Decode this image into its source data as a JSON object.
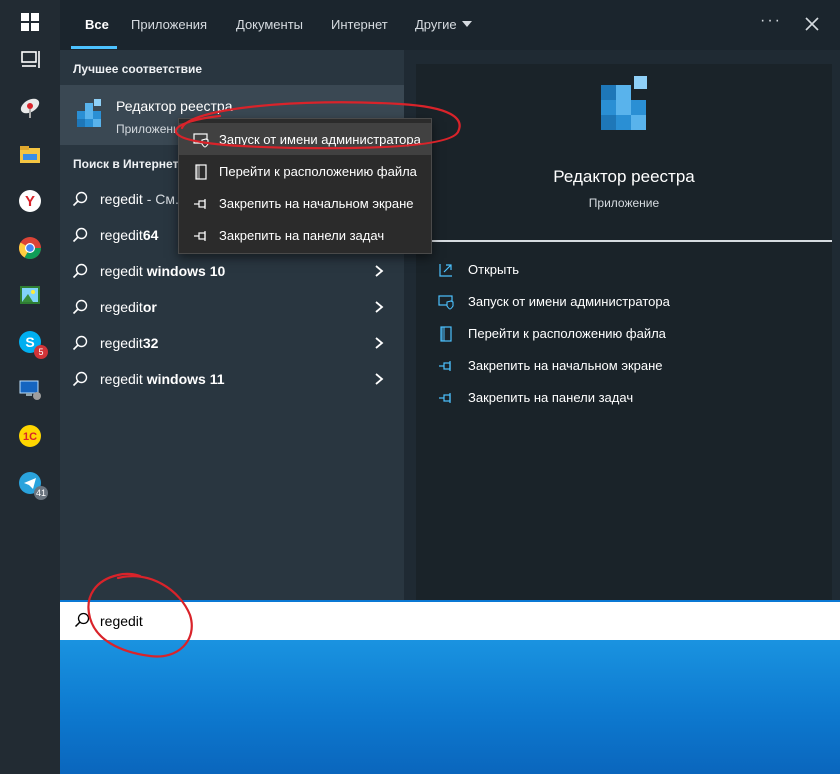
{
  "tabs": [
    {
      "label": "Все",
      "active": true
    },
    {
      "label": "Приложения"
    },
    {
      "label": "Документы"
    },
    {
      "label": "Интернет"
    },
    {
      "label": "Другие"
    }
  ],
  "more_label": "···",
  "best_match": {
    "section": "Лучшее соответствие",
    "title": "Редактор реестра",
    "subtitle": "Приложение"
  },
  "web": {
    "section": "Поиск в Интернете",
    "items": [
      {
        "prefix": "regedit",
        "suffix": " - См...",
        "bold_suffix": false
      },
      {
        "prefix": "regedit",
        "suffix": "64",
        "bold_suffix": true
      },
      {
        "prefix": "regedit",
        "suffix": " windows 10",
        "bold_suffix": true
      },
      {
        "prefix": "regedit",
        "suffix": "or",
        "bold_suffix": true
      },
      {
        "prefix": "regedit",
        "suffix": "32",
        "bold_suffix": true
      },
      {
        "prefix": "regedit",
        "suffix": " windows 11",
        "bold_suffix": true
      }
    ]
  },
  "context_menu": {
    "items": [
      {
        "label": "Запуск от имени администратора",
        "icon": "run-as-admin-icon"
      },
      {
        "label": "Перейти к расположению файла",
        "icon": "open-file-location-icon"
      },
      {
        "label": "Закрепить на начальном экране",
        "icon": "pin-icon"
      },
      {
        "label": "Закрепить на панели задач",
        "icon": "pin-icon"
      }
    ]
  },
  "details": {
    "title": "Редактор реестра",
    "subtitle": "Приложение",
    "actions": [
      {
        "label": "Открыть",
        "icon": "open-icon"
      },
      {
        "label": "Запуск от имени администратора",
        "icon": "run-as-admin-icon"
      },
      {
        "label": "Перейти к расположению файла",
        "icon": "open-file-location-icon"
      },
      {
        "label": "Закрепить на начальном экране",
        "icon": "pin-icon"
      },
      {
        "label": "Закрепить на панели задач",
        "icon": "pin-icon"
      }
    ]
  },
  "search": {
    "value": "regedit"
  },
  "taskbar": {
    "badges": {
      "skype": "5",
      "telegram": "41"
    }
  },
  "colors": {
    "accent": "#4cc2ff",
    "annotation": "#d9232a",
    "panel": "#1f2a33",
    "context_menu": "#2b2b2b"
  }
}
